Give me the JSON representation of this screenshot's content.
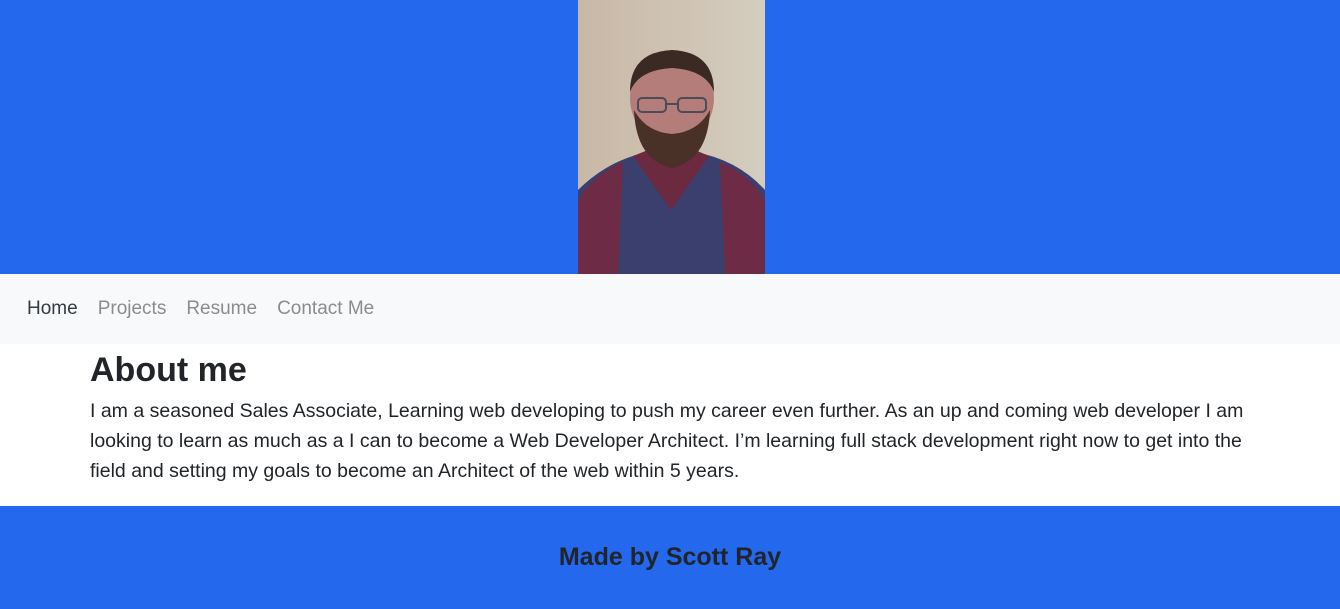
{
  "colors": {
    "brand_blue": "#2368ed",
    "nav_bg": "#f8f9fa",
    "nav_active": "#343a40",
    "nav_muted": "#8c8c8c",
    "text": "#212529"
  },
  "header": {
    "portrait_icon": "person-photo"
  },
  "nav": {
    "items": [
      {
        "label": "Home"
      },
      {
        "label": "Projects"
      },
      {
        "label": "Resume"
      },
      {
        "label": "Contact Me"
      }
    ]
  },
  "main": {
    "title": "About me",
    "body": "I am a seasoned Sales Associate, Learning web developing to push my career even further. As an up and coming web developer I am looking to learn as much as a I can to become a Web Developer Architect. I’m learning full stack development right now to get into the field and setting my goals to become an Architect of the web within 5 years."
  },
  "footer": {
    "text": "Made by Scott Ray"
  }
}
